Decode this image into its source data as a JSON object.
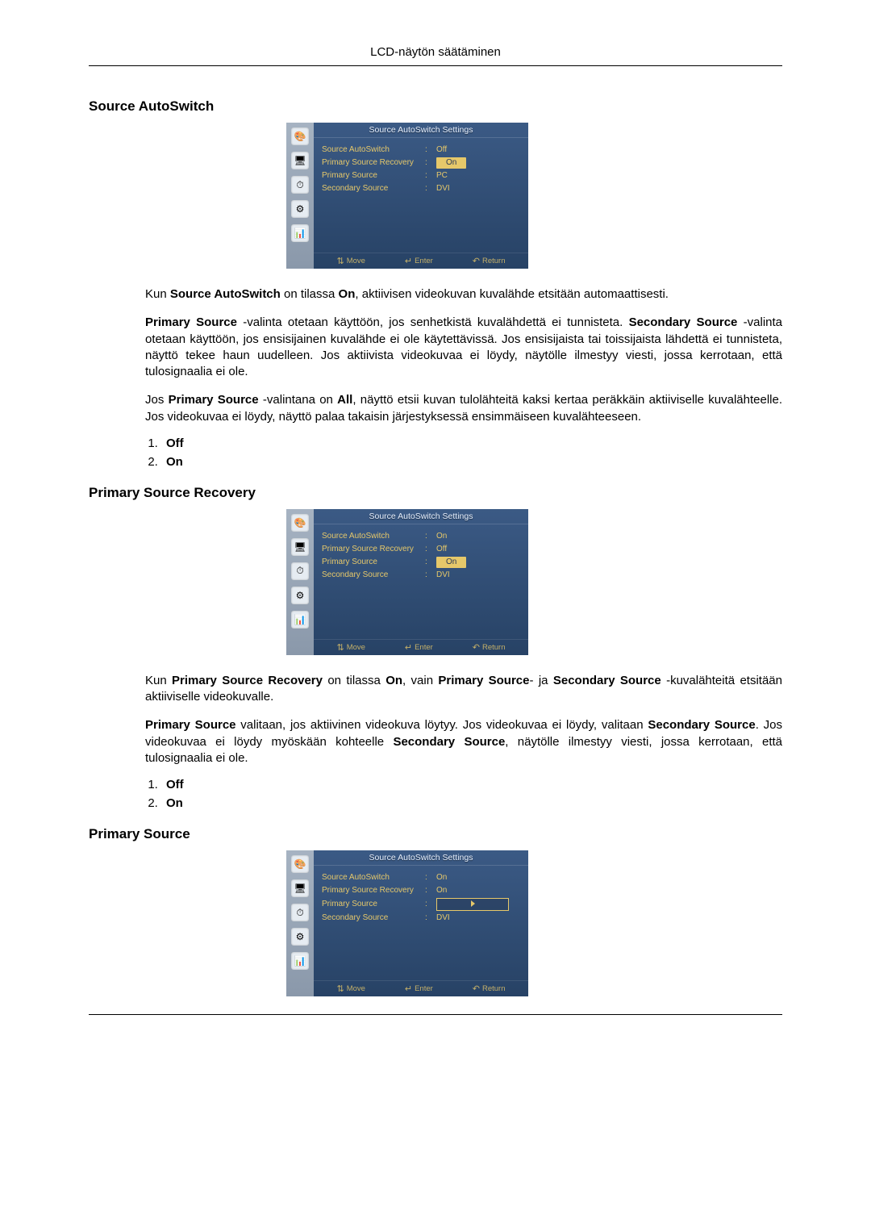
{
  "header": {
    "title": "LCD-näytön säätäminen"
  },
  "osd_common": {
    "panel_title": "Source AutoSwitch Settings",
    "labels": {
      "source_autoswitch": "Source AutoSwitch",
      "primary_source_recovery": "Primary Source Recovery",
      "primary_source": "Primary Source",
      "secondary_source": "Secondary Source"
    },
    "footer": {
      "move": "Move",
      "enter": "Enter",
      "return": "Return"
    },
    "icon_names": [
      "palette-icon",
      "display-icon",
      "clock-icon",
      "gear-icon",
      "barchart-icon"
    ]
  },
  "sections": [
    {
      "heading": "Source AutoSwitch",
      "osd": {
        "rows": [
          {
            "key": "source_autoswitch",
            "value": "Off",
            "state": "plain"
          },
          {
            "key": "primary_source_recovery",
            "value": "On",
            "state": "highlight"
          },
          {
            "key": "primary_source",
            "value": "PC",
            "state": "plain"
          },
          {
            "key": "secondary_source",
            "value": "DVI",
            "state": "plain"
          }
        ]
      },
      "paras": [
        [
          {
            "t": "Kun "
          },
          {
            "t": "Source AutoSwitch",
            "b": true
          },
          {
            "t": " on tilassa "
          },
          {
            "t": "On",
            "b": true
          },
          {
            "t": ", aktiivisen videokuvan kuvalähde etsitään automaattisesti."
          }
        ],
        [
          {
            "t": "Primary Source",
            "b": true
          },
          {
            "t": " -valinta otetaan käyttöön, jos senhetkistä kuvalähdettä ei tunnisteta. "
          },
          {
            "t": "Secondary Source",
            "b": true
          },
          {
            "t": " -valinta otetaan käyttöön, jos ensisijainen kuvalähde ei ole käytettävissä. Jos ensisijaista tai toissijaista lähdettä ei tunnisteta, näyttö tekee haun uudelleen. Jos aktiivista videokuvaa ei löydy, näytölle ilmestyy viesti, jossa kerrotaan, että tulosignaalia ei ole."
          }
        ],
        [
          {
            "t": "Jos "
          },
          {
            "t": "Primary Source",
            "b": true
          },
          {
            "t": " -valintana on "
          },
          {
            "t": "All",
            "b": true
          },
          {
            "t": ", näyttö etsii kuvan tulolähteitä kaksi kertaa peräkkäin aktiiviselle kuvalähteelle. Jos videokuvaa ei löydy, näyttö palaa takaisin järjestyksessä ensimmäiseen kuvalähteeseen."
          }
        ]
      ],
      "options": [
        "Off",
        "On"
      ]
    },
    {
      "heading": "Primary Source Recovery",
      "osd": {
        "rows": [
          {
            "key": "source_autoswitch",
            "value": "On",
            "state": "plain"
          },
          {
            "key": "primary_source_recovery",
            "value": "Off",
            "state": "plain"
          },
          {
            "key": "primary_source",
            "value": "On",
            "state": "highlight"
          },
          {
            "key": "secondary_source",
            "value": "DVI",
            "state": "plain"
          }
        ]
      },
      "paras": [
        [
          {
            "t": "Kun "
          },
          {
            "t": "Primary Source Recovery",
            "b": true
          },
          {
            "t": " on tilassa "
          },
          {
            "t": "On",
            "b": true
          },
          {
            "t": ", vain "
          },
          {
            "t": "Primary Source",
            "b": true
          },
          {
            "t": "- ja "
          },
          {
            "t": "Secondary Source",
            "b": true
          },
          {
            "t": " -kuvalähteitä etsitään aktiiviselle videokuvalle."
          }
        ],
        [
          {
            "t": "Primary Source",
            "b": true
          },
          {
            "t": " valitaan, jos aktiivinen videokuva löytyy. Jos videokuvaa ei löydy, valitaan "
          },
          {
            "t": "Secondary Source",
            "b": true
          },
          {
            "t": ". Jos videokuvaa ei löydy myöskään kohteelle "
          },
          {
            "t": "Secondary Source",
            "b": true
          },
          {
            "t": ", näytölle ilmestyy viesti, jossa kerrotaan, että tulosignaalia ei ole."
          }
        ]
      ],
      "options": [
        "Off",
        "On"
      ]
    },
    {
      "heading": "Primary Source",
      "osd": {
        "rows": [
          {
            "key": "source_autoswitch",
            "value": "On",
            "state": "plain"
          },
          {
            "key": "primary_source_recovery",
            "value": "On",
            "state": "plain"
          },
          {
            "key": "primary_source",
            "value": "",
            "state": "box"
          },
          {
            "key": "secondary_source",
            "value": "DVI",
            "state": "plain"
          }
        ]
      },
      "paras": [],
      "options": []
    }
  ]
}
